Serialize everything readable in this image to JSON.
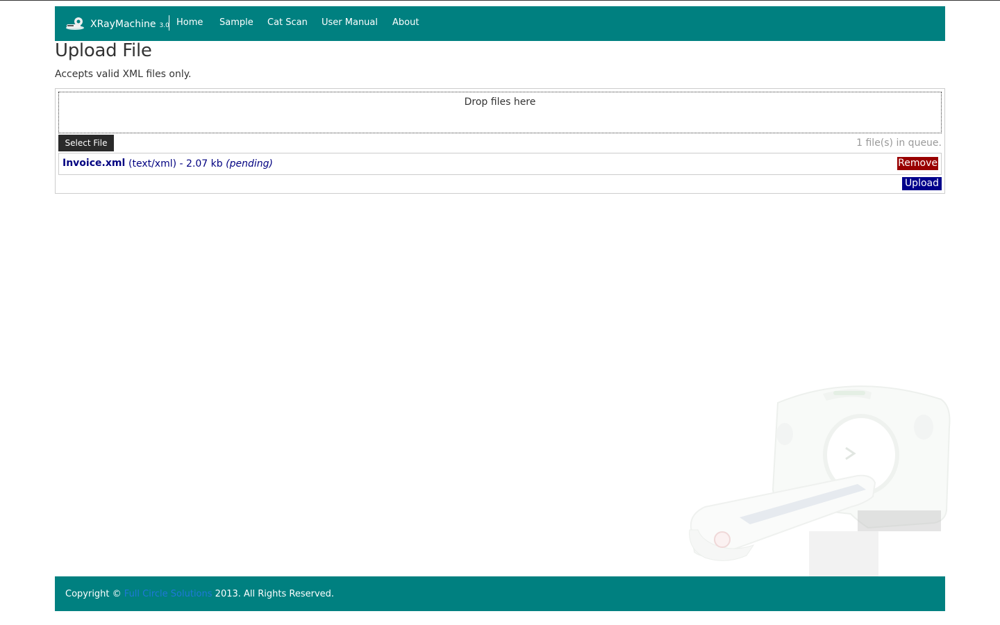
{
  "navbar": {
    "brand": "XRayMachine",
    "version": "3.0",
    "items": [
      {
        "label": "Home"
      },
      {
        "label": "Sample"
      },
      {
        "label": "Cat Scan"
      },
      {
        "label": "User Manual"
      },
      {
        "label": "About"
      }
    ],
    "background_color": "#008080"
  },
  "page": {
    "title": "Upload File",
    "subtitle": "Accepts valid XML files only."
  },
  "uploader": {
    "drop_label": "Drop files here",
    "select_button": "Select File",
    "queue_text": "1 file(s) in queue.",
    "files": [
      {
        "name": "Invoice.xml",
        "meta": "(text/xml) - 2.07 kb",
        "status": "(pending)",
        "remove_label": "Remove"
      }
    ],
    "upload_button": "Upload"
  },
  "footer": {
    "prefix": "Copyright ©",
    "link": "Full Circle Solutions",
    "suffix": "2013. All Rights Reserved."
  },
  "colors": {
    "accent": "#008080",
    "remove": "#990000",
    "upload": "#00008b",
    "file_text": "#000080",
    "footer_link": "#1f78d8"
  },
  "icons": {
    "brand": "xray-machine-icon",
    "background": "ct-scanner-illustration"
  }
}
